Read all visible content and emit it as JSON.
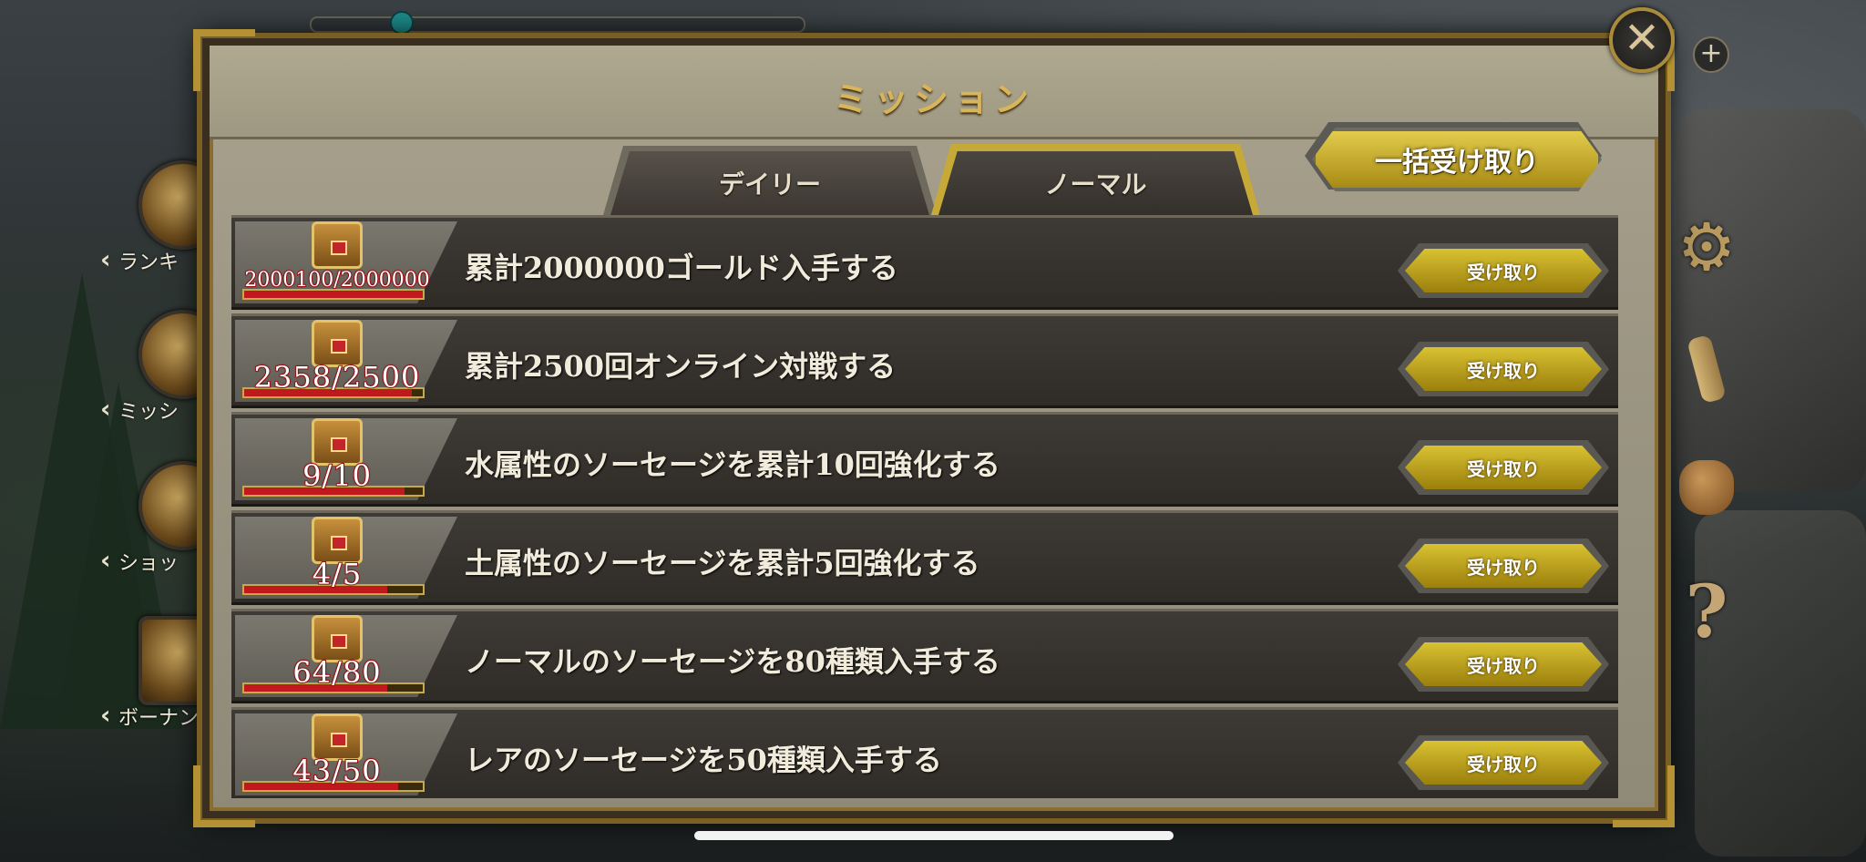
{
  "panel": {
    "title": "ミッション",
    "bulk_claim_label": "一括受け取り",
    "tabs": [
      {
        "label": "デイリー",
        "active": false
      },
      {
        "label": "ノーマル",
        "active": true
      }
    ]
  },
  "side_menu_left": [
    {
      "label": "ランキ",
      "icon": "ranking-icon"
    },
    {
      "label": "ミッシ",
      "icon": "mission-icon"
    },
    {
      "label": "ショッ",
      "icon": "shop-icon"
    },
    {
      "label": "ボーナン",
      "icon": "bonus-icon"
    }
  ],
  "side_menu_right": [
    "gear-icon",
    "scroll-icon",
    "bag-icon",
    "question-icon"
  ],
  "missions": [
    {
      "progress": "2000100/2000000",
      "progress_ratio": 1.0,
      "description": "累計2000000ゴールド入手する",
      "claim_label": "受け取り"
    },
    {
      "progress": "2358/2500",
      "progress_ratio": 0.94,
      "description": "累計2500回オンライン対戦する",
      "claim_label": "受け取り"
    },
    {
      "progress": "9/10",
      "progress_ratio": 0.9,
      "description": "水属性のソーセージを累計10回強化する",
      "claim_label": "受け取り"
    },
    {
      "progress": "4/5",
      "progress_ratio": 0.8,
      "description": "土属性のソーセージを累計5回強化する",
      "claim_label": "受け取り"
    },
    {
      "progress": "64/80",
      "progress_ratio": 0.8,
      "description": "ノーマルのソーセージを80種類入手する",
      "claim_label": "受け取り"
    },
    {
      "progress": "43/50",
      "progress_ratio": 0.86,
      "description": "レアのソーセージを50種類入手する",
      "claim_label": "受け取り"
    }
  ],
  "colors": {
    "gold_button": "#d9c232",
    "progress_red": "#c0191d",
    "title_gold": "#d8b45a"
  }
}
